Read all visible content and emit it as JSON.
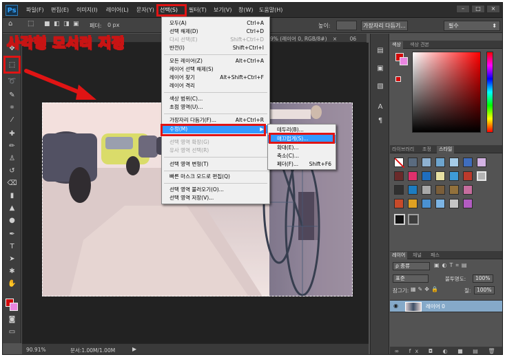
{
  "app": {
    "logo_text": "Ps"
  },
  "menubar": {
    "items": [
      "파일(F)",
      "편집(E)",
      "이미지(I)",
      "레이어(L)",
      "문자(Y)",
      "선택(S)",
      "필터(T)",
      "보기(V)",
      "창(W)",
      "도움말(H)"
    ],
    "active_item": "선택(S)",
    "window_buttons": [
      "–",
      "□",
      "×"
    ]
  },
  "options_bar": {
    "feather_label": "페더:",
    "feather_value": "0 px",
    "height_label": "높이:",
    "refine_edge_button": "가장자리 다듬기...",
    "workspace": "필수"
  },
  "document": {
    "tab_fragment": "9% (레이어 0, RGB/8#)",
    "tab_number": "06",
    "zoom": "90.91%",
    "doc_info": "문서:1.00M/1.00M"
  },
  "annotation": {
    "text": "사각형 모서리 지정",
    "color": "#e01414"
  },
  "select_menu": {
    "items": [
      {
        "label": "모두(A)",
        "shortcut": "Ctrl+A",
        "disabled": false
      },
      {
        "label": "선택 해제(D)",
        "shortcut": "Ctrl+D",
        "disabled": false
      },
      {
        "label": "다시 선택(E)",
        "shortcut": "Shift+Ctrl+D",
        "disabled": true
      },
      {
        "label": "반전(I)",
        "shortcut": "Shift+Ctrl+I",
        "disabled": false
      },
      {
        "label": "모든 레이어(Z)",
        "shortcut": "Alt+Ctrl+A",
        "disabled": false
      },
      {
        "label": "레이어 선택 해제(S)",
        "shortcut": "",
        "disabled": false
      },
      {
        "label": "레이어 찾기",
        "shortcut": "Alt+Shift+Ctrl+F",
        "disabled": false
      },
      {
        "label": "레이어 격리",
        "shortcut": "",
        "disabled": false
      },
      {
        "label": "색상 범위(C)...",
        "shortcut": "",
        "disabled": false
      },
      {
        "label": "초점 영역(U)...",
        "shortcut": "",
        "disabled": false
      },
      {
        "label": "가장자리 다듬기(F)...",
        "shortcut": "Alt+Ctrl+R",
        "disabled": false
      },
      {
        "label": "수정(M)",
        "shortcut": "",
        "disabled": false
      },
      {
        "label": "선택 영역 확장(G)",
        "shortcut": "",
        "disabled": true
      },
      {
        "label": "유사 영역 선택(R)",
        "shortcut": "",
        "disabled": true
      },
      {
        "label": "선택 영역 변형(T)",
        "shortcut": "",
        "disabled": false
      },
      {
        "label": "빠른 마스크 모드로 편집(Q)",
        "shortcut": "",
        "disabled": false
      },
      {
        "label": "선택 영역 불러오기(O)...",
        "shortcut": "",
        "disabled": false
      },
      {
        "label": "선택 영역 저장(V)...",
        "shortcut": "",
        "disabled": false
      }
    ],
    "highlighted": "수정(M)"
  },
  "modify_submenu": {
    "items": [
      {
        "label": "테두리(B)...",
        "shortcut": ""
      },
      {
        "label": "매끄럽게(S)...",
        "shortcut": ""
      },
      {
        "label": "확대(E)...",
        "shortcut": ""
      },
      {
        "label": "축소(C)...",
        "shortcut": ""
      },
      {
        "label": "페더(F)...",
        "shortcut": "Shift+F6"
      }
    ],
    "highlighted": "매끄럽게(S)..."
  },
  "panels": {
    "color_tabs": [
      "색상",
      "색상 견본"
    ],
    "styles_tabs": [
      "라이브러리",
      "조정",
      "스타일"
    ],
    "layers_tabs": [
      "레이어",
      "채널",
      "패스"
    ],
    "filter_kind": "ρ 종류",
    "blend_mode": "표준",
    "opacity_label": "불투명도:",
    "opacity_value": "100%",
    "lock_label": "잠그기:",
    "fill_label": "칠:",
    "fill_value": "100%",
    "layer_name": "레이어 0",
    "footer_icons": "∞ fx ◘ ◐ ■ ▤ 🗑"
  },
  "colors": {
    "foreground": "#d10a0a",
    "background": "#e985e0",
    "highlight": "#3399ff",
    "annotation_red": "#e01414"
  }
}
